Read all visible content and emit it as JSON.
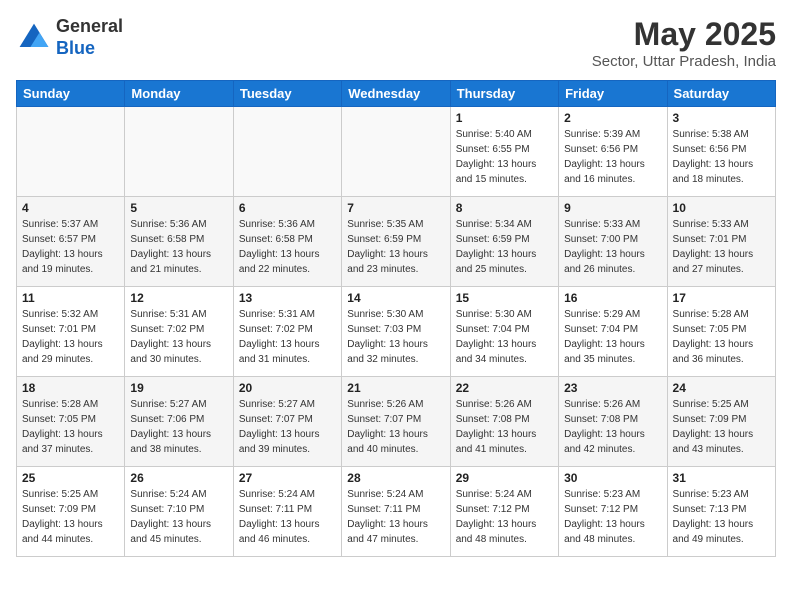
{
  "header": {
    "logo_line1": "General",
    "logo_line2": "Blue",
    "title": "May 2025",
    "subtitle": "Sector, Uttar Pradesh, India"
  },
  "weekdays": [
    "Sunday",
    "Monday",
    "Tuesday",
    "Wednesday",
    "Thursday",
    "Friday",
    "Saturday"
  ],
  "weeks": [
    [
      {
        "day": "",
        "info": ""
      },
      {
        "day": "",
        "info": ""
      },
      {
        "day": "",
        "info": ""
      },
      {
        "day": "",
        "info": ""
      },
      {
        "day": "1",
        "info": "Sunrise: 5:40 AM\nSunset: 6:55 PM\nDaylight: 13 hours\nand 15 minutes."
      },
      {
        "day": "2",
        "info": "Sunrise: 5:39 AM\nSunset: 6:56 PM\nDaylight: 13 hours\nand 16 minutes."
      },
      {
        "day": "3",
        "info": "Sunrise: 5:38 AM\nSunset: 6:56 PM\nDaylight: 13 hours\nand 18 minutes."
      }
    ],
    [
      {
        "day": "4",
        "info": "Sunrise: 5:37 AM\nSunset: 6:57 PM\nDaylight: 13 hours\nand 19 minutes."
      },
      {
        "day": "5",
        "info": "Sunrise: 5:36 AM\nSunset: 6:58 PM\nDaylight: 13 hours\nand 21 minutes."
      },
      {
        "day": "6",
        "info": "Sunrise: 5:36 AM\nSunset: 6:58 PM\nDaylight: 13 hours\nand 22 minutes."
      },
      {
        "day": "7",
        "info": "Sunrise: 5:35 AM\nSunset: 6:59 PM\nDaylight: 13 hours\nand 23 minutes."
      },
      {
        "day": "8",
        "info": "Sunrise: 5:34 AM\nSunset: 6:59 PM\nDaylight: 13 hours\nand 25 minutes."
      },
      {
        "day": "9",
        "info": "Sunrise: 5:33 AM\nSunset: 7:00 PM\nDaylight: 13 hours\nand 26 minutes."
      },
      {
        "day": "10",
        "info": "Sunrise: 5:33 AM\nSunset: 7:01 PM\nDaylight: 13 hours\nand 27 minutes."
      }
    ],
    [
      {
        "day": "11",
        "info": "Sunrise: 5:32 AM\nSunset: 7:01 PM\nDaylight: 13 hours\nand 29 minutes."
      },
      {
        "day": "12",
        "info": "Sunrise: 5:31 AM\nSunset: 7:02 PM\nDaylight: 13 hours\nand 30 minutes."
      },
      {
        "day": "13",
        "info": "Sunrise: 5:31 AM\nSunset: 7:02 PM\nDaylight: 13 hours\nand 31 minutes."
      },
      {
        "day": "14",
        "info": "Sunrise: 5:30 AM\nSunset: 7:03 PM\nDaylight: 13 hours\nand 32 minutes."
      },
      {
        "day": "15",
        "info": "Sunrise: 5:30 AM\nSunset: 7:04 PM\nDaylight: 13 hours\nand 34 minutes."
      },
      {
        "day": "16",
        "info": "Sunrise: 5:29 AM\nSunset: 7:04 PM\nDaylight: 13 hours\nand 35 minutes."
      },
      {
        "day": "17",
        "info": "Sunrise: 5:28 AM\nSunset: 7:05 PM\nDaylight: 13 hours\nand 36 minutes."
      }
    ],
    [
      {
        "day": "18",
        "info": "Sunrise: 5:28 AM\nSunset: 7:05 PM\nDaylight: 13 hours\nand 37 minutes."
      },
      {
        "day": "19",
        "info": "Sunrise: 5:27 AM\nSunset: 7:06 PM\nDaylight: 13 hours\nand 38 minutes."
      },
      {
        "day": "20",
        "info": "Sunrise: 5:27 AM\nSunset: 7:07 PM\nDaylight: 13 hours\nand 39 minutes."
      },
      {
        "day": "21",
        "info": "Sunrise: 5:26 AM\nSunset: 7:07 PM\nDaylight: 13 hours\nand 40 minutes."
      },
      {
        "day": "22",
        "info": "Sunrise: 5:26 AM\nSunset: 7:08 PM\nDaylight: 13 hours\nand 41 minutes."
      },
      {
        "day": "23",
        "info": "Sunrise: 5:26 AM\nSunset: 7:08 PM\nDaylight: 13 hours\nand 42 minutes."
      },
      {
        "day": "24",
        "info": "Sunrise: 5:25 AM\nSunset: 7:09 PM\nDaylight: 13 hours\nand 43 minutes."
      }
    ],
    [
      {
        "day": "25",
        "info": "Sunrise: 5:25 AM\nSunset: 7:09 PM\nDaylight: 13 hours\nand 44 minutes."
      },
      {
        "day": "26",
        "info": "Sunrise: 5:24 AM\nSunset: 7:10 PM\nDaylight: 13 hours\nand 45 minutes."
      },
      {
        "day": "27",
        "info": "Sunrise: 5:24 AM\nSunset: 7:11 PM\nDaylight: 13 hours\nand 46 minutes."
      },
      {
        "day": "28",
        "info": "Sunrise: 5:24 AM\nSunset: 7:11 PM\nDaylight: 13 hours\nand 47 minutes."
      },
      {
        "day": "29",
        "info": "Sunrise: 5:24 AM\nSunset: 7:12 PM\nDaylight: 13 hours\nand 48 minutes."
      },
      {
        "day": "30",
        "info": "Sunrise: 5:23 AM\nSunset: 7:12 PM\nDaylight: 13 hours\nand 48 minutes."
      },
      {
        "day": "31",
        "info": "Sunrise: 5:23 AM\nSunset: 7:13 PM\nDaylight: 13 hours\nand 49 minutes."
      }
    ]
  ]
}
